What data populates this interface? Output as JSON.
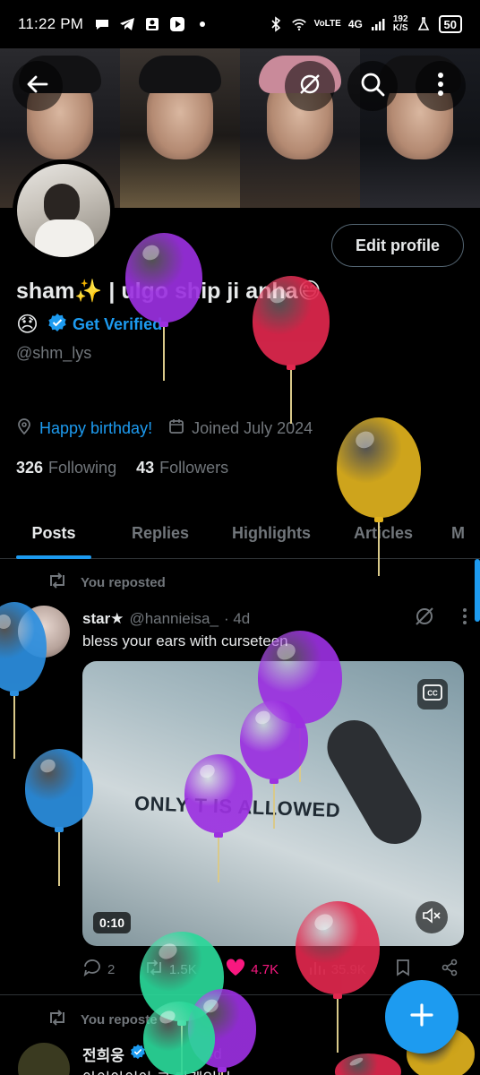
{
  "status_bar": {
    "time": "11:22 PM",
    "network_label": "VoLTE",
    "signal": "4G",
    "speed_value": "192",
    "speed_unit": "K/S",
    "battery": "50"
  },
  "header": {
    "back_icon": "back-arrow-icon",
    "grok_icon": "grok-icon",
    "search_icon": "search-icon",
    "more_icon": "more-vertical-icon"
  },
  "profile": {
    "edit_label": "Edit profile",
    "name": "sham✨ | ulgo ship ji anha😅",
    "status_emoji": "😞",
    "get_verified": "Get Verified",
    "handle": "@shm_lys",
    "birthday_link": "Happy birthday!",
    "joined": "Joined July 2024",
    "following_count": "326",
    "following_label": "Following",
    "followers_count": "43",
    "followers_label": "Followers"
  },
  "tabs": [
    {
      "label": "Posts",
      "active": true
    },
    {
      "label": "Replies",
      "active": false
    },
    {
      "label": "Highlights",
      "active": false
    },
    {
      "label": "Articles",
      "active": false
    },
    {
      "label": "M",
      "active": false
    }
  ],
  "posts": [
    {
      "repost_label": "You reposted",
      "author": "star★",
      "handle": "@hannieisa_",
      "time": "· 4d",
      "text": "bless your ears with curseteen",
      "media_text": "ONLY  T IS ALLOWED",
      "duration": "0:10",
      "replies": "2",
      "reposts": "1.5K",
      "likes": "4.7K",
      "views": "35.9K"
    },
    {
      "repost_label": "You reposte",
      "author": "전희웅",
      "time": "4d",
      "text": "아이아이아 그 가겠입니"
    }
  ],
  "colors": {
    "accent": "#1d9bf0",
    "like": "#f91880",
    "muted": "#71767b",
    "text": "#e7e9ea"
  }
}
